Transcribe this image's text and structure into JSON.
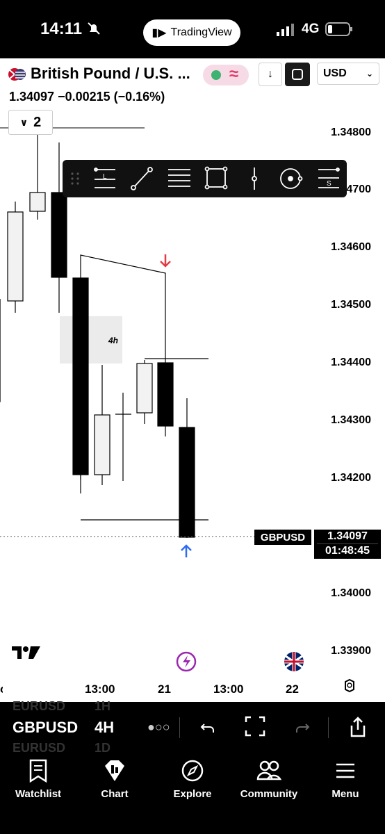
{
  "status_bar": {
    "time": "14:11",
    "center_label": "TradingView",
    "network": "4G"
  },
  "header": {
    "symbol_title": "British Pound / U.S. ...",
    "quote": "1.34097 −0.00215 (−0.16%)",
    "currency": "USD",
    "interval_count": "2",
    "toggle_icon": "≈"
  },
  "price_axis": {
    "labels": [
      "1.34800",
      "1.34700",
      "1.34600",
      "1.34500",
      "1.34400",
      "1.34300",
      "1.34200",
      "1.34000",
      "1.33900"
    ]
  },
  "drawing_toolbar": {
    "tools": [
      "long-position-tool",
      "trend-line-tool",
      "fib-tool",
      "rectangle-tool",
      "vertical-line-tool",
      "circle-tool",
      "short-position-tool"
    ]
  },
  "chart": {
    "zone_label": "4h",
    "symbol_tag": "GBPUSD",
    "last_price": "1.34097",
    "countdown": "01:48:45",
    "time_labels": [
      "13:00",
      "21",
      "13:00",
      "22"
    ]
  },
  "symbol_bar": {
    "symbol": "GBPUSD",
    "interval": "4H",
    "prev_symbol": "EURUSD",
    "prev_interval": "1H",
    "next_symbol": "EURUSD",
    "next_interval": "1D"
  },
  "bottom_nav": {
    "watchlist": "Watchlist",
    "chart": "Chart",
    "explore": "Explore",
    "community": "Community",
    "menu": "Menu"
  },
  "colors": {
    "accent_red": "#e23b44",
    "accent_blue": "#2f6cf0",
    "bolt_purple": "#9c27b0"
  }
}
